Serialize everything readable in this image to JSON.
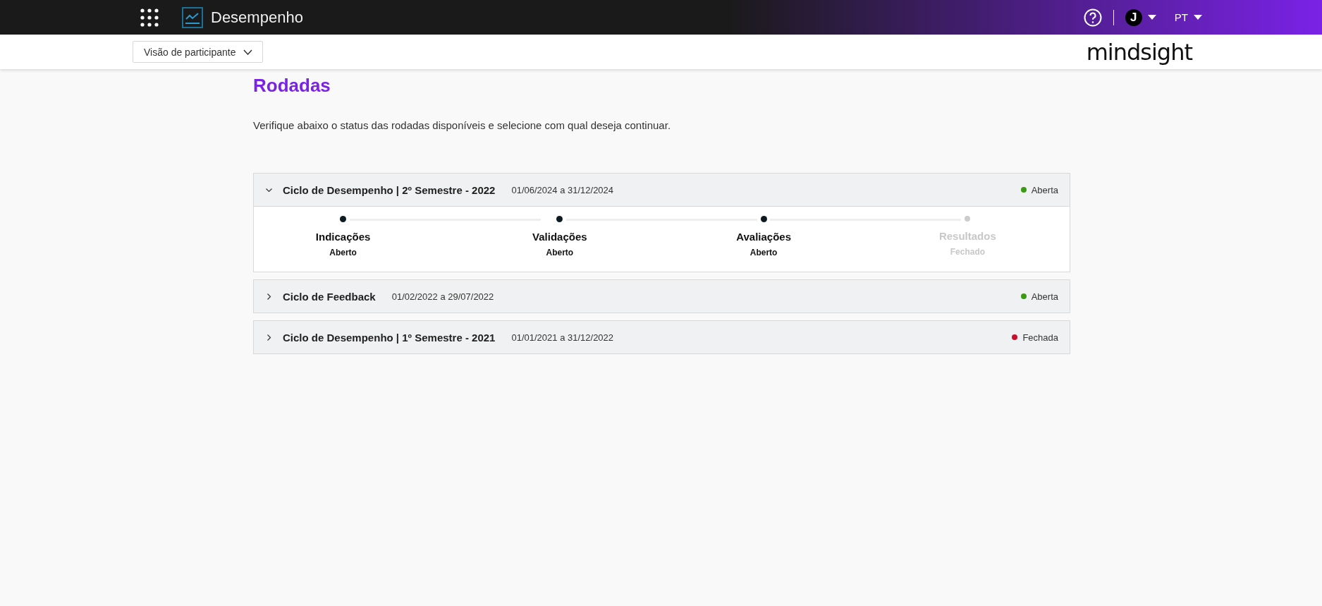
{
  "topbar": {
    "app_name": "Desempenho",
    "avatar_initial": "J",
    "language": "PT"
  },
  "subbar": {
    "view_selector": "Visão de participante",
    "brand": "mindsight"
  },
  "page": {
    "title": "Rodadas",
    "description": "Verifique abaixo o status das rodadas disponíveis e selecione com qual deseja continuar."
  },
  "rounds": [
    {
      "title": "Ciclo de Desempenho | 2º Semestre - 2022",
      "dates": "01/06/2024 a 31/12/2024",
      "status": "Aberta",
      "color": "#3a9a14",
      "expanded": true,
      "stages": [
        {
          "name": "Indicações",
          "status": "Aberto",
          "active": true
        },
        {
          "name": "Validações",
          "status": "Aberto",
          "active": true
        },
        {
          "name": "Avaliações",
          "status": "Aberto",
          "active": true
        },
        {
          "name": "Resultados",
          "status": "Fechado",
          "active": false
        }
      ]
    },
    {
      "title": "Ciclo de Feedback",
      "dates": "01/02/2022 a 29/07/2022",
      "status": "Aberta",
      "color": "#3a9a14",
      "expanded": false
    },
    {
      "title": "Ciclo de Desempenho | 1º Semestre - 2021",
      "dates": "01/01/2021 a 31/12/2022",
      "status": "Fechada",
      "color": "#c8102e",
      "expanded": false
    }
  ]
}
